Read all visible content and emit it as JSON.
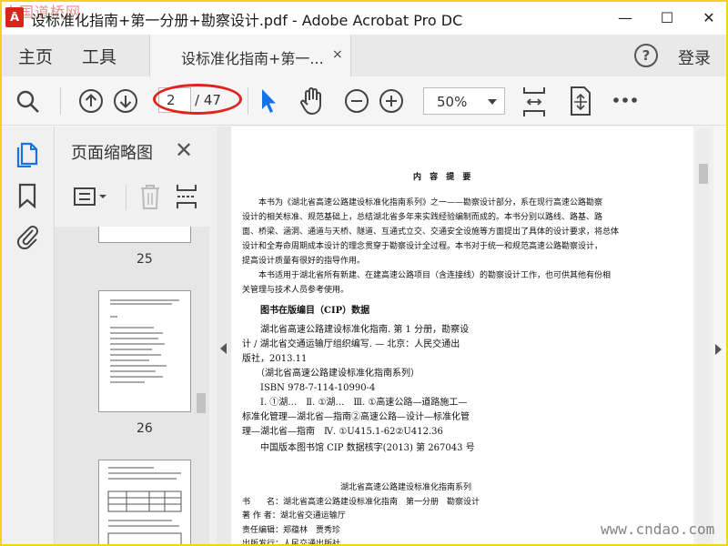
{
  "window": {
    "title": "设标准化指南+第一分册+勘察设计.pdf - Adobe Acrobat Pro DC",
    "app_icon_label": "A",
    "watermark_top": "中国道桥网",
    "minimize_glyph": "—",
    "maximize_glyph": "☐",
    "close_glyph": "✕"
  },
  "menu": {
    "home": "主页",
    "tools": "工具",
    "doc_tab": "设标准化指南+第一...",
    "doc_tab_close": "×",
    "help": "?",
    "login": "登录"
  },
  "toolbar": {
    "current_page": "2",
    "total_pages": "/ 47",
    "zoom": "50%",
    "icons": [
      "search-icon",
      "page-up-icon",
      "page-down-icon",
      "pointer-icon",
      "hand-icon",
      "zoom-out-icon",
      "zoom-in-icon",
      "fit-width-icon",
      "scroll-mode-icon",
      "more-icon"
    ]
  },
  "annotation": {
    "color": "#e0241c"
  },
  "rail": {
    "icons": [
      "page-thumbnails-icon",
      "bookmark-icon",
      "attachment-icon"
    ],
    "accent_color": "#1473e6"
  },
  "thumbnail_panel": {
    "title": "页面缩略图",
    "close": "✕",
    "page_labels": [
      "25",
      "26"
    ]
  },
  "document": {
    "heading": "内 容 提 要",
    "paragraph1": [
      "　　本书为《湖北省高速公路建设标准化指南系列》之一——勘察设计部分，系在现行高速公路勘察",
      "设计的相关标准、规范基础上，总结湖北省多年来实践经验编制而成的。本书分别以路线、路基、路",
      "面、桥梁、涵洞、通道与天桥、隧道、互通式立交、交通安全设施等方面提出了具体的设计要求，将总体",
      "设计和全寿命周期成本设计的理念贯穿于勘察设计全过程。本书对于统一和规范高速公路勘察设计，",
      "提高设计质量有很好的指导作用。"
    ],
    "paragraph2": [
      "　　本书适用于湖北省所有新建、在建高速公路项目（含连接线）的勘察设计工作，也可供其他有份相",
      "关管理与技术人员参考使用。"
    ],
    "cip_title": "图书在版编目（CIP）数据",
    "cip_lines": [
      "　　湖北省高速公路建设标准化指南. 第 1 分册，勘察设",
      "计 / 湖北省交通运输厅组织编写. — 北京：人民交通出",
      "版社，2013.11",
      "　　（湖北省高速公路建设标准化指南系列）",
      "　　ISBN  978-7-114-10990-4",
      "",
      "　　Ⅰ. ①湖…　Ⅱ. ①湖…　Ⅲ. ①高速公路—道路施工—",
      "标准化管理—湖北省—指南②高速公路—设计—标准化管",
      "理—湖北省—指南　Ⅳ. ①U415.1-62②U412.36",
      "",
      "　　中国版本图书馆 CIP 数据核字(2013) 第 267043 号"
    ],
    "colophon": [
      "　　　　　　　　　　　　湖北省高速公路建设标准化指南系列",
      "书　　名：湖北省高速公路建设标准化指南　第一分册　勘察设计",
      "著 作 者：湖北省交通运输厅",
      "责任编辑：郑蕴林　贾秀珍",
      "出版发行：人民交通出版社"
    ]
  },
  "watermark_bottom": "www.cndao.com"
}
